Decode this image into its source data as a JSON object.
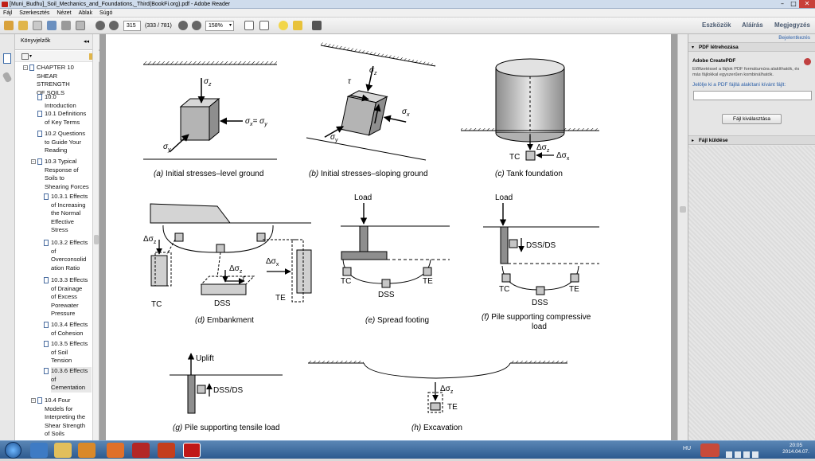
{
  "window": {
    "title": "[Muni_Budhu]_Soil_Mechanics_and_Foundations,_Third(BookFi.org).pdf - Adobe Reader"
  },
  "menu": [
    "Fájl",
    "Szerkesztés",
    "Nézet",
    "Ablak",
    "Súgó"
  ],
  "toolbar": {
    "page_current": "315",
    "page_count": "(333 / 781)",
    "zoom": "158%",
    "tools": "Eszközök",
    "sign": "Aláírás",
    "comment": "Megjegyzés"
  },
  "bookmarks": {
    "title": "Könyvjelzők",
    "items": [
      {
        "text": "CHAPTER 10 SHEAR STRENGTH OF SOILS",
        "lines": [
          "CHAPTER 10",
          "SHEAR STRENGTH",
          "OF SOILS"
        ]
      },
      {
        "text": "10.0 Introduction",
        "lines": [
          "10.0",
          "Introduction"
        ]
      },
      {
        "text": "10.1 Definitions of Key Terms",
        "lines": [
          "10.1 Definitions",
          "of Key Terms"
        ]
      },
      {
        "text": "10.2 Questions to Guide Your Reading",
        "lines": [
          "10.2 Questions",
          "to Guide Your",
          "Reading"
        ]
      },
      {
        "text": "10.3 Typical Response of Soils to Shearing Forces",
        "lines": [
          "10.3 Typical",
          "Response of",
          "Soils to",
          "Shearing Forces"
        ]
      },
      {
        "text": "10.3.1 Effects of Increasing the Normal Effective Stress",
        "lines": [
          "10.3.1 Effects",
          "of Increasing",
          "the Normal",
          "Effective",
          "Stress"
        ]
      },
      {
        "text": "10.3.2 Effects of Overconsolidation Ratio",
        "lines": [
          "10.3.2 Effects",
          "of",
          "Overconsolid",
          "ation Ratio"
        ]
      },
      {
        "text": "10.3.3 Effects of Drainage of Excess Porewater Pressure",
        "lines": [
          "10.3.3 Effects",
          "of Drainage",
          "of Excess",
          "Porewater",
          "Pressure"
        ]
      },
      {
        "text": "10.3.4 Effects of Cohesion",
        "lines": [
          "10.3.4 Effects",
          "of Cohesion"
        ]
      },
      {
        "text": "10.3.5 Effects of Soil Tension",
        "lines": [
          "10.3.5 Effects",
          "of Soil",
          "Tension"
        ]
      },
      {
        "text": "10.3.6 Effects of Cementation",
        "lines": [
          "10.3.6 Effects",
          "of",
          "Cementation"
        ]
      },
      {
        "text": "10.4 Four Models for Interpreting the Shear Strength of Soils",
        "lines": [
          "10.4 Four",
          "Models for",
          "Interpreting the",
          "Shear Strength",
          "of Soils"
        ]
      }
    ]
  },
  "right_panel": {
    "login": "Bejelentkezés",
    "section_pdf": "PDF létrehozása",
    "createpdf_title": "Adobe CreatePDF",
    "createpdf_desc_1": "Előfizetéssel a fájlok PDF formátumúra alakíthatók, és",
    "createpdf_desc_2": "más fájlokkal egyszerűen kombinálhatók.",
    "select_label": "Jelölje ki a PDF fájllá alakítani kívánt fájlt:",
    "select_button": "Fájl kiválasztása",
    "section_send": "Fájl küldése"
  },
  "figure": {
    "cap_a_letter": "(a)",
    "cap_a": " Initial stresses–level ground",
    "cap_b_letter": "(b)",
    "cap_b": " Initial stresses–sloping ground",
    "cap_c_letter": "(c)",
    "cap_c": " Tank foundation",
    "cap_d_letter": "(d)",
    "cap_d": " Embankment",
    "cap_e_letter": "(e)",
    "cap_e": " Spread footing",
    "cap_f_letter": "(f)",
    "cap_f1": " Pile supporting compressive",
    "cap_f2": "load",
    "cap_g_letter": "(g)",
    "cap_g": " Pile supporting tensile load",
    "cap_h_letter": "(h)",
    "cap_h": " Excavation",
    "sigma": "σ",
    "sub_z": "z",
    "sub_x": "x",
    "sub_y": "y",
    "eq_x_y": "= σ",
    "tau": "τ",
    "delta": "Δσ",
    "tc": "TC",
    "te": "TE",
    "dss": "DSS",
    "dss_ds": "DSS/DS",
    "load": "Load",
    "uplift": "Uplift"
  },
  "taskbar": {
    "lang": "HU",
    "time": "20:05",
    "date": "2014.04.07."
  }
}
